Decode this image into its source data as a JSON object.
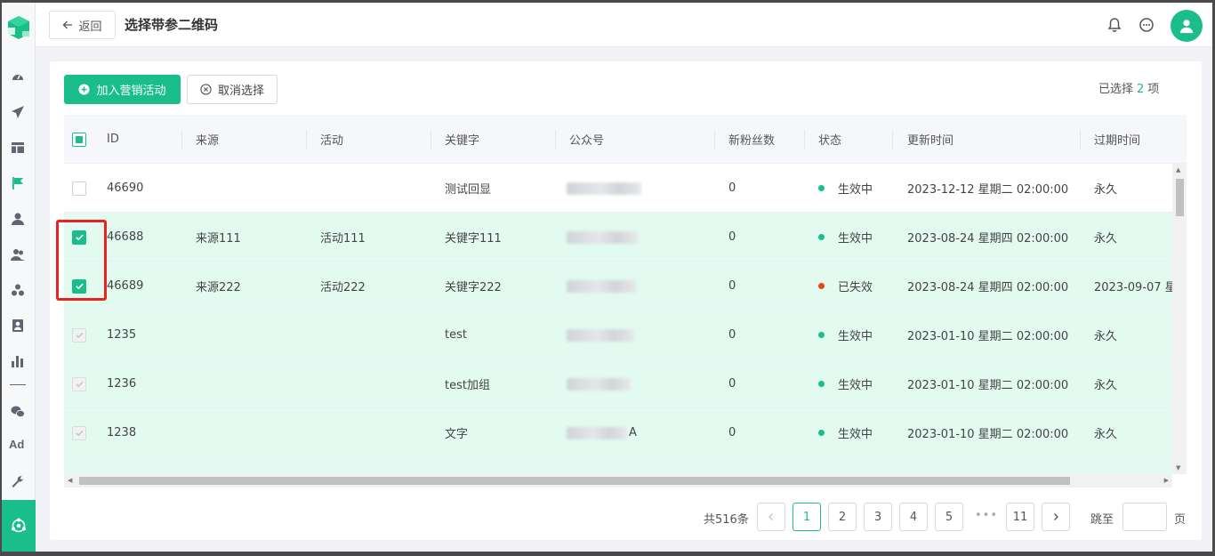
{
  "colors": {
    "primary": "#19be8b",
    "active_status": "#19be8b",
    "expired_status": "#e8461c",
    "highlight_box": "#e8231c"
  },
  "header": {
    "back_label": "返回",
    "title": "选择带参二维码",
    "icons": [
      "bell-icon",
      "chat-icon",
      "user-icon"
    ]
  },
  "sidebar": {
    "icons": [
      "dashboard-icon",
      "send-icon",
      "layout-icon",
      "flag-icon",
      "user-icon",
      "users-icon",
      "group-icon",
      "portrait-icon",
      "bar-chart-icon",
      "wechat-icon",
      "ad-icon",
      "wrench-icon",
      "hub-icon"
    ],
    "ad_label": "Ad"
  },
  "toolbar": {
    "add_label": "加入营销活动",
    "cancel_label": "取消选择",
    "selected_prefix": "已选择",
    "selected_count": "2",
    "selected_suffix": "项"
  },
  "table": {
    "columns": [
      "ID",
      "来源",
      "活动",
      "关键字",
      "公众号",
      "新粉丝数",
      "状态",
      "更新时间",
      "过期时间"
    ],
    "rows": [
      {
        "checkbox": "unchecked",
        "id": "46690",
        "source": "",
        "activity": "",
        "keyword": "测试回显",
        "account_suffix": "",
        "new_fans": "0",
        "status": "生效中",
        "status_type": "active",
        "updated": "2023-12-12 星期二 02:00:00",
        "expires": "永久"
      },
      {
        "checkbox": "checked",
        "id": "46688",
        "source": "来源111",
        "activity": "活动111",
        "keyword": "关键字111",
        "account_suffix": "",
        "new_fans": "0",
        "status": "生效中",
        "status_type": "active",
        "updated": "2023-08-24 星期四 02:00:00",
        "expires": "永久"
      },
      {
        "checkbox": "checked",
        "id": "46689",
        "source": "来源222",
        "activity": "活动222",
        "keyword": "关键字222",
        "account_suffix": "",
        "new_fans": "0",
        "status": "已失效",
        "status_type": "expired",
        "updated": "2023-08-24 星期四 02:00:00",
        "expires": "2023-09-07 星"
      },
      {
        "checkbox": "disabled",
        "id": "1235",
        "source": "",
        "activity": "",
        "keyword": "test",
        "account_suffix": "",
        "new_fans": "0",
        "status": "生效中",
        "status_type": "active",
        "updated": "2023-01-10 星期二 02:00:00",
        "expires": "永久"
      },
      {
        "checkbox": "disabled",
        "id": "1236",
        "source": "",
        "activity": "",
        "keyword": "test加组",
        "account_suffix": "",
        "new_fans": "0",
        "status": "生效中",
        "status_type": "active",
        "updated": "2023-01-10 星期二 02:00:00",
        "expires": "永久"
      },
      {
        "checkbox": "disabled",
        "id": "1238",
        "source": "",
        "activity": "",
        "keyword": "文字",
        "account_suffix": "A",
        "new_fans": "0",
        "status": "生效中",
        "status_type": "active",
        "updated": "2023-01-10 星期二 02:00:00",
        "expires": "永久"
      }
    ]
  },
  "pagination": {
    "total_label": "共516条",
    "pages": [
      "1",
      "2",
      "3",
      "4",
      "5"
    ],
    "last_page": "11",
    "ellipsis": "•••",
    "current": "1",
    "jump_label": "跳至",
    "page_label": "页"
  }
}
